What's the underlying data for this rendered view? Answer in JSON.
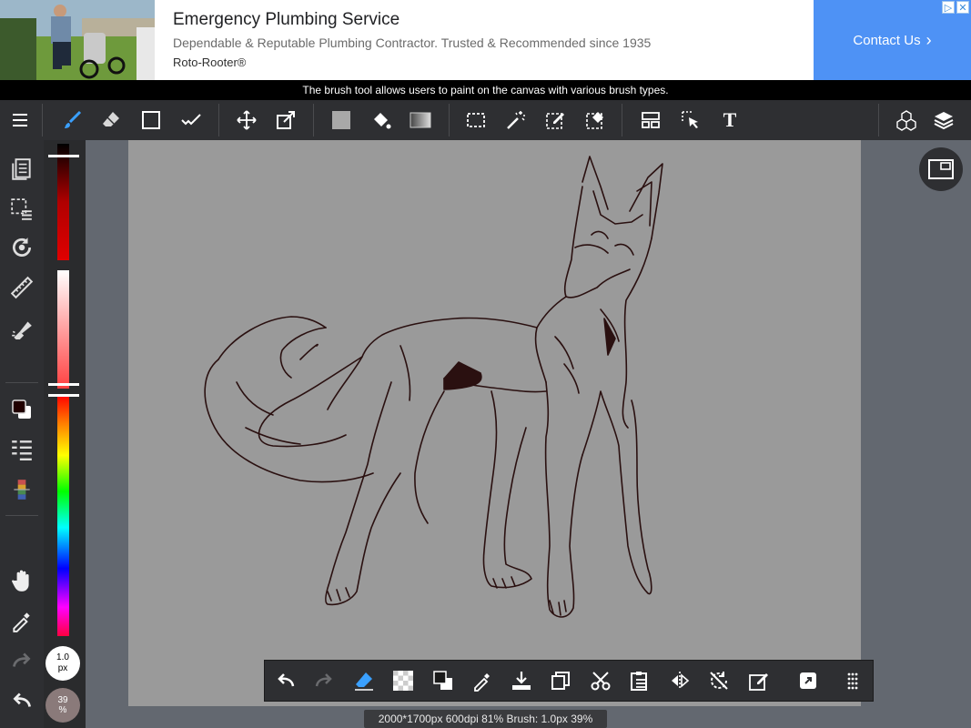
{
  "ad": {
    "title": "Emergency Plumbing Service",
    "description": "Dependable & Reputable Plumbing Contractor. Trusted & Recommended since 1935",
    "brand": "Roto-Rooter®",
    "cta_label": "Contact Us",
    "cta_color": "#4e92f5"
  },
  "tooltip": "The brush tool allows users to paint on the canvas with various brush types.",
  "toolbar": {
    "tools": [
      "menu-icon",
      "brush-icon",
      "eraser-icon",
      "rectangle-icon",
      "dot-pen-icon",
      "move-icon",
      "transform-icon",
      "fill-color-icon",
      "bucket-icon",
      "gradient-icon",
      "select-rect-icon",
      "magic-wand-icon",
      "select-pen-icon",
      "select-eraser-icon",
      "layout-icon",
      "select-layer-icon",
      "text-icon",
      "3d-icon",
      "layers-icon"
    ],
    "text_tool_glyph": "T"
  },
  "sidebar": {
    "items": [
      "pages-icon",
      "selection-icon",
      "rotate-icon",
      "ruler-icon",
      "filter-icon",
      "color-swatch-icon",
      "layer-list-icon",
      "palette-icon",
      "hand-icon",
      "eyedropper-icon",
      "redo-icon",
      "undo-icon"
    ]
  },
  "color": {
    "primary": "#200000",
    "secondary": "#ffffff",
    "brush_size_value": "1.0",
    "brush_size_unit": "px",
    "opacity_value": "39",
    "opacity_unit": "%"
  },
  "canvas": {
    "background": "#9a9a9a",
    "line_color": "#2a1010"
  },
  "bottom_toolbar": {
    "items": [
      "undo-icon",
      "redo-icon",
      "clear-icon",
      "transparent-icon",
      "swap-color-icon",
      "eyedropper-icon",
      "save-icon",
      "copy-icon",
      "cut-icon",
      "paste-icon",
      "flip-icon",
      "rotate-icon",
      "transform-icon",
      "share-icon",
      "grid-icon"
    ]
  },
  "status": "2000*1700px 600dpi 81% Brush: 1.0px 39%"
}
